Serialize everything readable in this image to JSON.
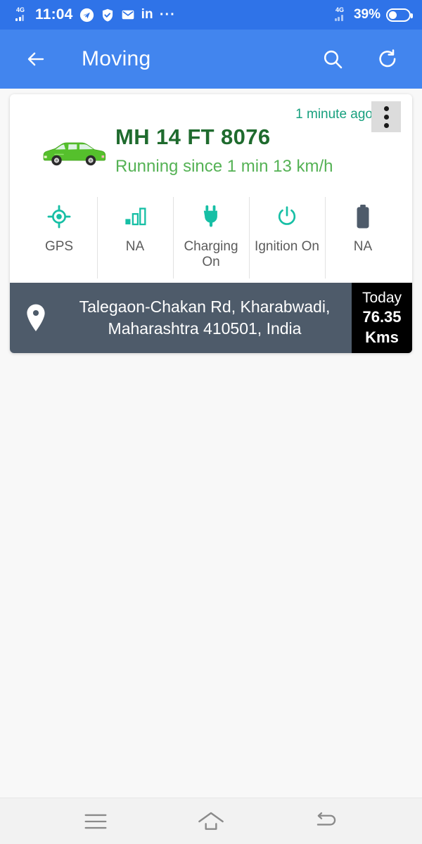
{
  "status_bar": {
    "network_label": "4G",
    "time": "11:04",
    "icons": [
      "telegram-icon",
      "shield-check-icon",
      "mail-icon",
      "linkedin-icon",
      "more-icon"
    ],
    "linkedin_label": "in",
    "more_label": "···",
    "right_network_label": "4G",
    "battery_percent": "39%"
  },
  "app_bar": {
    "back_label": "back-arrow",
    "title": "Moving",
    "search_label": "search",
    "refresh_label": "refresh"
  },
  "card": {
    "timestamp": "1 minute ago",
    "menu_label": "overflow-menu",
    "vehicle_image": "green-mpv-car",
    "plate": "MH 14 FT 8076",
    "status_text": "Running since 1 min 13 km/h",
    "stats": [
      {
        "icon": "gps-icon",
        "label": "GPS",
        "color": "#16bfa5"
      },
      {
        "icon": "signal-bars-icon",
        "label": "NA",
        "color": "#16bfa5"
      },
      {
        "icon": "charging-plug-icon",
        "label": "Charging On",
        "color": "#16bfa5"
      },
      {
        "icon": "ignition-power-icon",
        "label": "Ignition On",
        "color": "#16bfa5"
      },
      {
        "icon": "battery-icon",
        "label": "NA",
        "color": "#4e5b6a"
      }
    ],
    "address": {
      "pin_icon": "location-pin-icon",
      "line1": "Talegaon-Chakan Rd, Kharabwadi,",
      "line2": "Maharashtra 410501, India"
    },
    "distance": {
      "period": "Today",
      "value": "76.35",
      "unit": "Kms"
    }
  },
  "nav_bar": {
    "recents_label": "recents",
    "home_label": "home",
    "back_label": "back"
  },
  "colors": {
    "status_bar_bg": "#2f73e8",
    "app_bar_bg": "#4285ee",
    "page_bg": "#f8f8f8",
    "teal_accent": "#16bfa5",
    "plate_green": "#1f6b2e",
    "status_green": "#55b255",
    "timestamp_teal": "#17a07e",
    "address_bg": "#4e5b6a",
    "distance_bg": "#000000"
  }
}
